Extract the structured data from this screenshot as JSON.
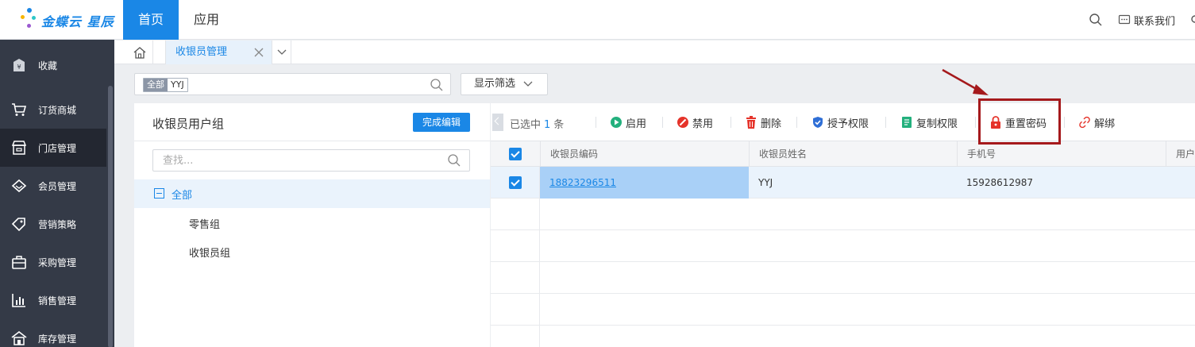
{
  "brand": {
    "name": "金蝶云 星辰"
  },
  "topnav": {
    "home": "首页",
    "apps": "应用",
    "contact": "联系我们"
  },
  "sidebar": {
    "items": [
      {
        "label": "收藏",
        "icon": "favorite-icon"
      },
      {
        "label": "订货商城",
        "icon": "cart-icon"
      },
      {
        "label": "门店管理",
        "icon": "store-icon"
      },
      {
        "label": "会员管理",
        "icon": "diamond-icon"
      },
      {
        "label": "营销策略",
        "icon": "tag-icon"
      },
      {
        "label": "采购管理",
        "icon": "bag-icon"
      },
      {
        "label": "销售管理",
        "icon": "bar-chart-icon"
      },
      {
        "label": "库存管理",
        "icon": "warehouse-icon"
      }
    ]
  },
  "tabs": {
    "active": "收银员管理"
  },
  "filter": {
    "chip_key": "全部",
    "chip_value": "YYJ",
    "show_filter": "显示筛选"
  },
  "group_panel": {
    "title": "收银员用户组",
    "done_button": "完成编辑",
    "search_placeholder": "查找...",
    "tree_root": "全部",
    "tree_children": [
      "零售组",
      "收银员组"
    ]
  },
  "toolbar": {
    "selected_prefix": "已选中",
    "selected_count": "1",
    "selected_suffix": "条",
    "enable": "启用",
    "disable": "禁用",
    "delete": "删除",
    "grant": "授予权限",
    "copy": "复制权限",
    "reset_password": "重置密码",
    "unbind": "解绑"
  },
  "grid": {
    "columns": [
      "收银员编码",
      "收银员姓名",
      "手机号",
      "用户"
    ],
    "rows": [
      {
        "code": "18823296511",
        "name": "YYJ",
        "phone": "15928612987",
        "selected": true
      }
    ]
  },
  "colors": {
    "accent": "#1a87e6",
    "sidebar_bg": "#343a47",
    "annotation": "#a5191c"
  }
}
